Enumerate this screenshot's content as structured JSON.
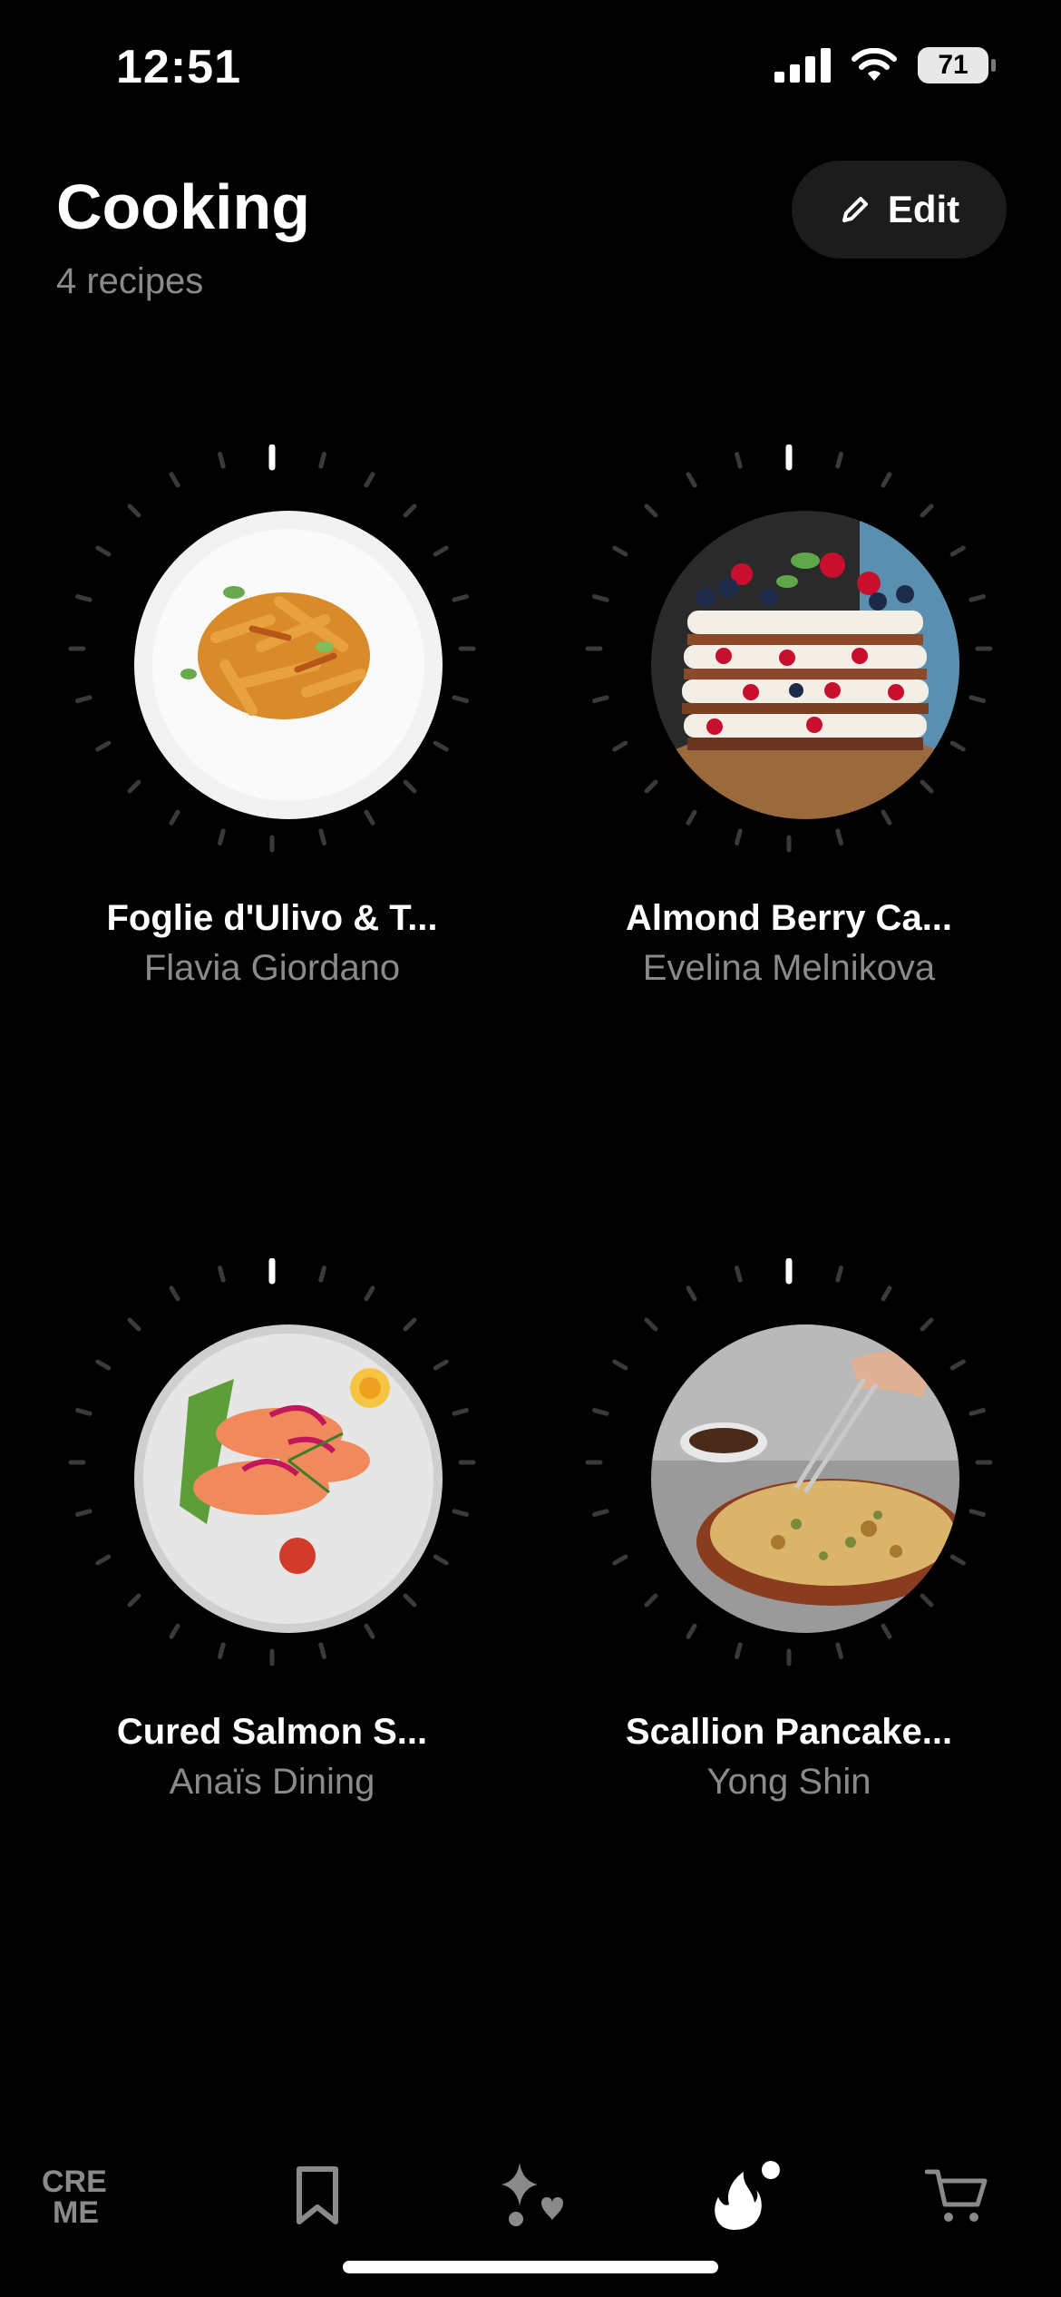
{
  "status": {
    "time": "12:51",
    "battery": "71"
  },
  "header": {
    "title": "Cooking",
    "subtitle": "4 recipes",
    "edit_label": "Edit"
  },
  "recipes": [
    {
      "title": "Foglie d'Ulivo & T...",
      "author": "Flavia Giordano",
      "image": "pasta-plate"
    },
    {
      "title": "Almond Berry Ca...",
      "author": "Evelina Melnikova",
      "image": "berry-layer-cake"
    },
    {
      "title": "Cured Salmon S...",
      "author": "Anaïs Dining",
      "image": "salmon-salad"
    },
    {
      "title": "Scallion Pancake...",
      "author": "Yong Shin",
      "image": "scallion-pancake"
    }
  ],
  "tabbar": {
    "items": [
      "creme-logo",
      "bookmark-icon",
      "sparkle-heart-icon",
      "flame-icon",
      "cart-icon"
    ],
    "logo_text": [
      "CRE",
      "ME"
    ],
    "active": "flame-icon"
  }
}
